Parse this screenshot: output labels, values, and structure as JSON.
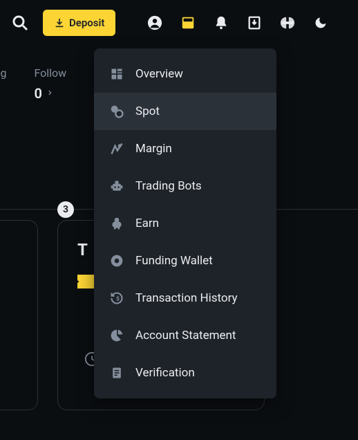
{
  "topbar": {
    "deposit_label": "Deposit"
  },
  "secondary": {
    "left_label": "ving",
    "follow_label": "Follow",
    "follow_count": "0"
  },
  "dropdown": {
    "items": [
      {
        "label": "Overview"
      },
      {
        "label": "Spot"
      },
      {
        "label": "Margin"
      },
      {
        "label": "Trading Bots"
      },
      {
        "label": "Earn"
      },
      {
        "label": "Funding Wallet"
      },
      {
        "label": "Transaction History"
      },
      {
        "label": "Account Statement"
      },
      {
        "label": "Verification"
      }
    ]
  },
  "card": {
    "title_partial": "T",
    "step_badge": "3"
  }
}
